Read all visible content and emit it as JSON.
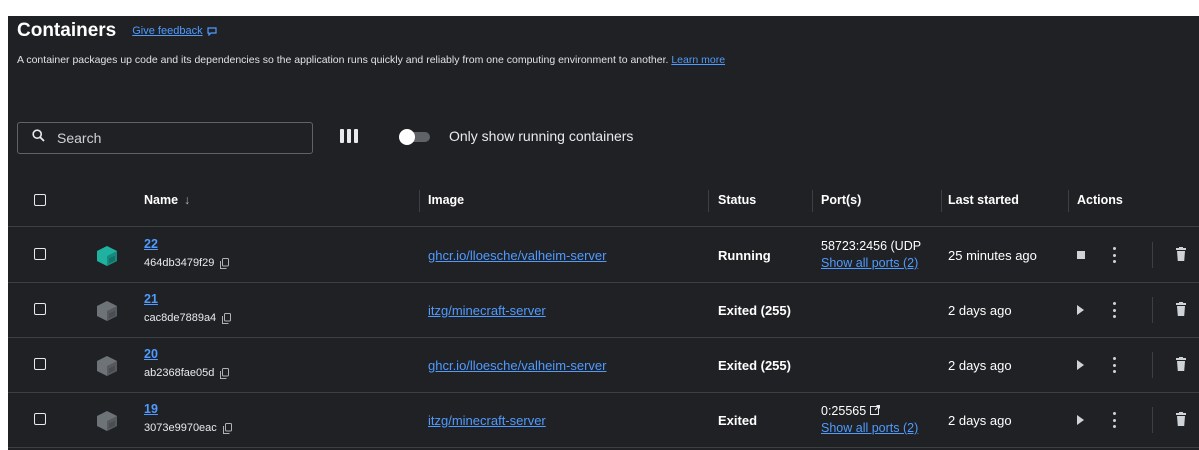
{
  "header": {
    "title": "Containers",
    "feedback_label": "Give feedback",
    "description": "A container packages up code and its dependencies so the application runs quickly and reliably from one computing environment to another.",
    "learn_more": "Learn more"
  },
  "toolbar": {
    "search_placeholder": "Search",
    "toggle_label": "Only show running containers",
    "toggle_on": false
  },
  "table": {
    "columns": [
      "Name",
      "Image",
      "Status",
      "Port(s)",
      "Last started",
      "Actions"
    ],
    "rows": [
      {
        "name": "22",
        "id": "464db3479f29",
        "image": "ghcr.io/lloesche/valheim-server",
        "status": "Running",
        "port": "58723:2456 (UDP",
        "port_link": "Show all ports (2)",
        "last_started": "25 minutes ago",
        "icon_color": "#20b2a0",
        "action": "stop-icon"
      },
      {
        "name": "21",
        "id": "cac8de7889a4",
        "image": "itzg/minecraft-server",
        "status": "Exited (255)",
        "port": "",
        "port_link": "",
        "last_started": "2 days ago",
        "icon_color": "#6e7378",
        "action": "play-icon"
      },
      {
        "name": "20",
        "id": "ab2368fae05d",
        "image": "ghcr.io/lloesche/valheim-server",
        "status": "Exited (255)",
        "port": "",
        "port_link": "",
        "last_started": "2 days ago",
        "icon_color": "#6e7378",
        "action": "play-icon"
      },
      {
        "name": "19",
        "id": "3073e9970eac",
        "image": "itzg/minecraft-server",
        "status": "Exited",
        "port": "0:25565",
        "port_link": "Show all ports (2)",
        "last_started": "2 days ago",
        "icon_color": "#6e7378",
        "action": "play-icon"
      }
    ]
  },
  "colors": {
    "background": "#202124",
    "link": "#4f9bff",
    "running_icon": "#20b2a0",
    "exited_icon": "#6e7378"
  }
}
